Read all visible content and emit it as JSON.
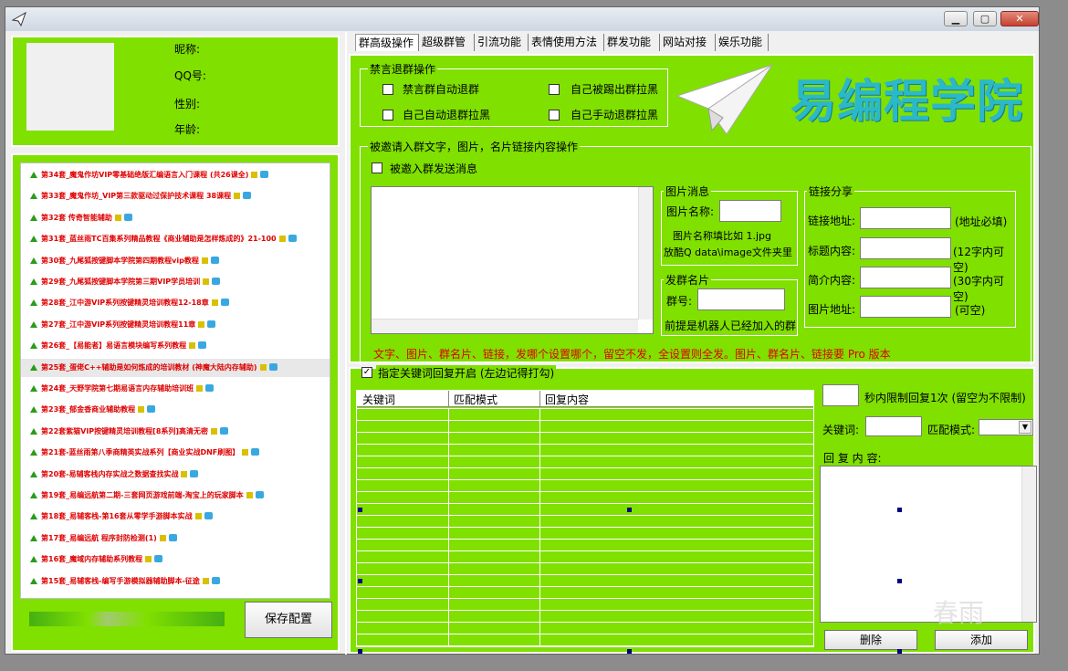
{
  "profile": {
    "nickname_label": "昵称:",
    "qq_label": "QQ号:",
    "gender_label": "性别:",
    "age_label": "年龄:"
  },
  "tabs": [
    "群高级操作",
    "超级群管",
    "引流功能",
    "表情使用方法",
    "群发功能",
    "网站对接",
    "娱乐功能"
  ],
  "courses": [
    "第34套_魔鬼作坊VIP零基础绝版汇编语言入门课程 (共26课全)",
    "第33套_魔鬼作坊_VIP第三款驱动过保护技术课程 38课程",
    "第32套 传奇智能辅助",
    "第31套_蓝丝雨TC百集系列精品教程《商业辅助是怎样炼成的》21-100",
    "第30套_九尾狐按键脚本学院第四期教程vip教程",
    "第29套_九尾狐按键脚本学院第三期VIP学员培训",
    "第28套_江中游VIP系列按键精灵培训教程12-18章",
    "第27套_江中游VIP系列按键精灵培训教程11章",
    "第26套_【易能者】易语言模块编写系列教程",
    "第25套_蛋佬C++辅助是如何炼成的培训教材 (神魔大陆内存辅助)",
    "第24套_天野学院第七期易语言内存辅助培训班",
    "第23套_郁金香商业辅助教程",
    "第22套紫猫VIP按键精灵培训教程[8系列]高清无密",
    "第21套-蓝丝雨第八季商精英实战系列【商业实战DNF刷图】",
    "第20套-易辅客栈内存实战之数据查找实战",
    "第19套_易编远航第二期-三套网页游戏前端-淘宝上的玩家脚本",
    "第18套_易辅客栈-第16套从零学手游脚本实战",
    "第17套_易编远航 程序封防检测(1)",
    "第16套_魔域内存辅助系列教程",
    "第15套_易辅客栈-编写手游模拟器辅助脚本-征途"
  ],
  "save_button": "保存配置",
  "ban": {
    "title": "禁言退群操作",
    "opt1": "禁言群自动退群",
    "opt2": "自己被踢出群拉黑",
    "opt3": "自己自动退群拉黑",
    "opt4": "自己手动退群拉黑"
  },
  "brand": "易编程学院",
  "invite": {
    "title": "被邀请入群文字，图片，名片链接内容操作",
    "send_label": "被邀入群发送消息"
  },
  "image_msg": {
    "title": "图片消息",
    "name_label": "图片名称:",
    "hint1": "图片名称填比如 1.jpg",
    "hint2": "放酷Q data\\image文件夹里"
  },
  "card": {
    "title": "发群名片",
    "group_label": "群号:",
    "hint": "前提是机器人已经加入的群"
  },
  "link": {
    "title": "链接分享",
    "addr_label": "链接地址:",
    "addr_hint": "(地址必填)",
    "title_label": "标题内容:",
    "title_hint": "(12字内可空)",
    "desc_label": "简介内容:",
    "desc_hint": "(30字内可空)",
    "img_label": "图片地址:",
    "img_hint": "(可空)"
  },
  "warning": "文字、图片、群名片、链接，发哪个设置哪个，留空不发，全设置则全发。图片、群名片、链接要 Pro 版本",
  "keyword": {
    "enable_label": "指定关键词回复开启 (左边记得打勾)",
    "col1": "关键词",
    "col2": "匹配模式",
    "col3": "回复内容",
    "limit_label": "秒内限制回复1次 (留空为不限制)",
    "kw_label": "关键词:",
    "mode_label": "匹配模式:",
    "content_label": "回 复 内 容:",
    "delete_button": "删除",
    "add_button": "添加"
  },
  "watermark": "春雨",
  "colors": {
    "panel": "#80e000",
    "warning": "#e00000",
    "brand": "#2bb8c8"
  }
}
